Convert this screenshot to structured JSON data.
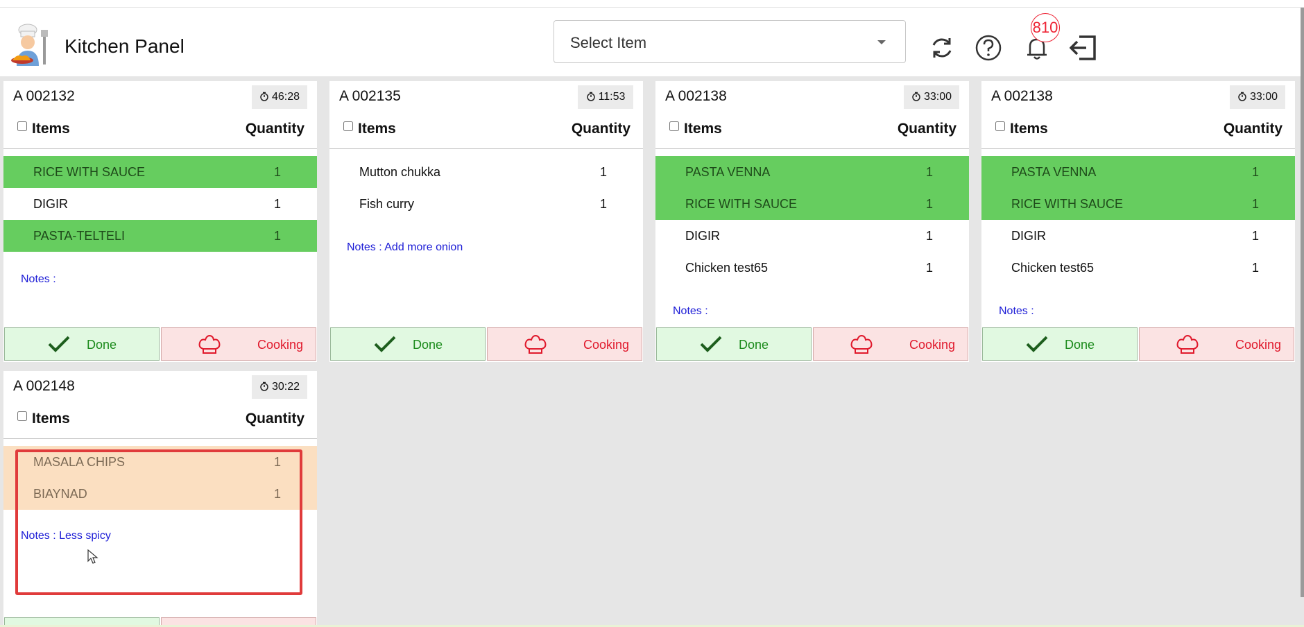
{
  "header": {
    "title": "Kitchen Panel",
    "select_placeholder": "Select Item",
    "notification_count": "810"
  },
  "labels": {
    "items": "Items",
    "quantity": "Quantity",
    "done": "Done",
    "cooking": "Cooking"
  },
  "orders": [
    {
      "id": "A 002132",
      "timer": "46:28",
      "items": [
        {
          "name": "RICE WITH SAUCE",
          "qty": "1",
          "status": "green"
        },
        {
          "name": "DIGIR",
          "qty": "1",
          "status": "none"
        },
        {
          "name": "PASTA-TELTELI",
          "qty": "1",
          "status": "green"
        }
      ],
      "notes": "Notes :"
    },
    {
      "id": "A 002135",
      "timer": "11:53",
      "items": [
        {
          "name": "Mutton chukka",
          "qty": "1",
          "status": "none"
        },
        {
          "name": "Fish curry",
          "qty": "1",
          "status": "none"
        }
      ],
      "notes": "Notes : Add more onion"
    },
    {
      "id": "A 002138",
      "timer": "33:00",
      "items": [
        {
          "name": "PASTA VENNA",
          "qty": "1",
          "status": "green"
        },
        {
          "name": "RICE WITH SAUCE",
          "qty": "1",
          "status": "green"
        },
        {
          "name": "DIGIR",
          "qty": "1",
          "status": "none"
        },
        {
          "name": "Chicken test65",
          "qty": "1",
          "status": "none"
        }
      ],
      "notes": "Notes :"
    },
    {
      "id": "A 002138",
      "timer": "33:00",
      "items": [
        {
          "name": "PASTA VENNA",
          "qty": "1",
          "status": "green"
        },
        {
          "name": "RICE WITH SAUCE",
          "qty": "1",
          "status": "green"
        },
        {
          "name": "DIGIR",
          "qty": "1",
          "status": "none"
        },
        {
          "name": "Chicken test65",
          "qty": "1",
          "status": "none"
        }
      ],
      "notes": "Notes :"
    },
    {
      "id": "A 002148",
      "timer": "30:22",
      "items": [
        {
          "name": "MASALA CHIPS",
          "qty": "1",
          "status": "peach"
        },
        {
          "name": "BIAYNAD",
          "qty": "1",
          "status": "peach"
        }
      ],
      "notes": "Notes : Less spicy"
    }
  ],
  "colors": {
    "ready": "#66cd5f",
    "pending": "#fbdfc1",
    "notes": "#1b1bd6",
    "done": "#1a8a1a",
    "cooking": "#e0192c"
  }
}
